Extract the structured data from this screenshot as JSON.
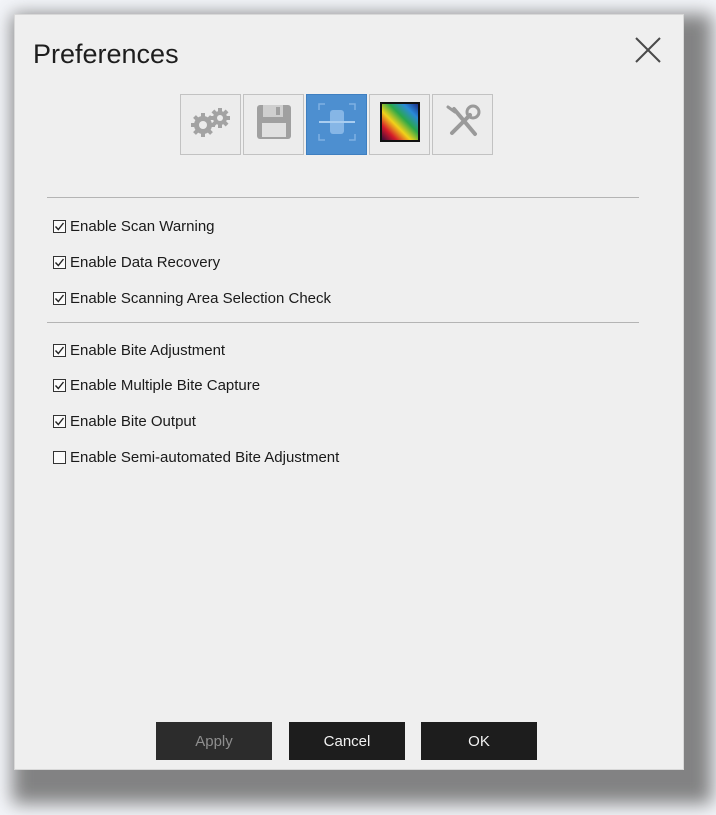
{
  "dialog": {
    "title": "Preferences",
    "close_icon": "close-icon"
  },
  "tabs": [
    {
      "icon": "gears-icon",
      "active": false
    },
    {
      "icon": "floppy-disk-icon",
      "active": false
    },
    {
      "icon": "scan-area-icon",
      "active": true
    },
    {
      "icon": "color-gradient-icon",
      "active": false
    },
    {
      "icon": "tools-icon",
      "active": false
    }
  ],
  "options": [
    {
      "label": "Enable Scan Warning",
      "checked": true
    },
    {
      "label": "Enable Data Recovery",
      "checked": true
    },
    {
      "label": "Enable Scanning Area Selection Check",
      "checked": true
    },
    {
      "label": "Enable Bite Adjustment",
      "checked": true
    },
    {
      "label": "Enable Multiple Bite Capture",
      "checked": true
    },
    {
      "label": "Enable Bite Output",
      "checked": true
    },
    {
      "label": "Enable Semi-automated Bite Adjustment",
      "checked": false
    }
  ],
  "buttons": {
    "apply": "Apply",
    "cancel": "Cancel",
    "ok": "OK",
    "apply_disabled": true
  },
  "colors": {
    "active_tab": "#4d8fd0",
    "button_bg": "#1d1d1d",
    "dialog_bg": "#efefef"
  }
}
